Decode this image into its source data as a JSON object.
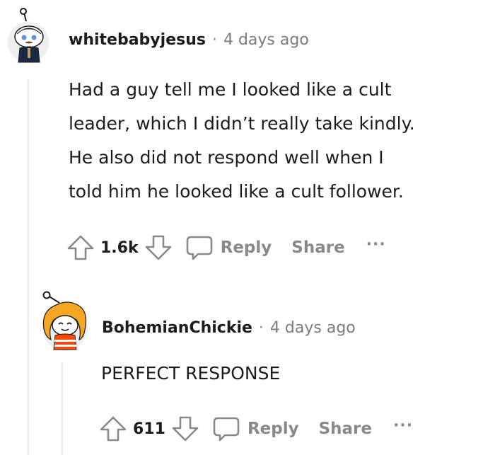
{
  "comments": [
    {
      "username": "whitebabyjesus",
      "separator": "·",
      "timestamp": "4 days ago",
      "lines": [
        "Had a guy tell me I looked like a cult",
        "leader, which I didn’t really take kindly.",
        "He also did not respond well when I",
        "told him he looked like a cult follower."
      ],
      "votes": "1.6k",
      "reply_label": "Reply",
      "share_label": "Share",
      "more_label": "···"
    },
    {
      "username": "BohemianChickie",
      "separator": "·",
      "timestamp": "4 days ago",
      "lines": [
        "PERFECT RESPONSE"
      ],
      "votes": "611",
      "reply_label": "Reply",
      "share_label": "Share",
      "more_label": "···"
    }
  ],
  "colors": {
    "text": "#1c1c1c",
    "muted": "#878a8c",
    "thread_line": "#edeff1"
  },
  "icons": {
    "upvote": "upvote-arrow-icon",
    "downvote": "downvote-arrow-icon",
    "comment": "speech-bubble-icon",
    "more": "ellipsis-icon"
  }
}
